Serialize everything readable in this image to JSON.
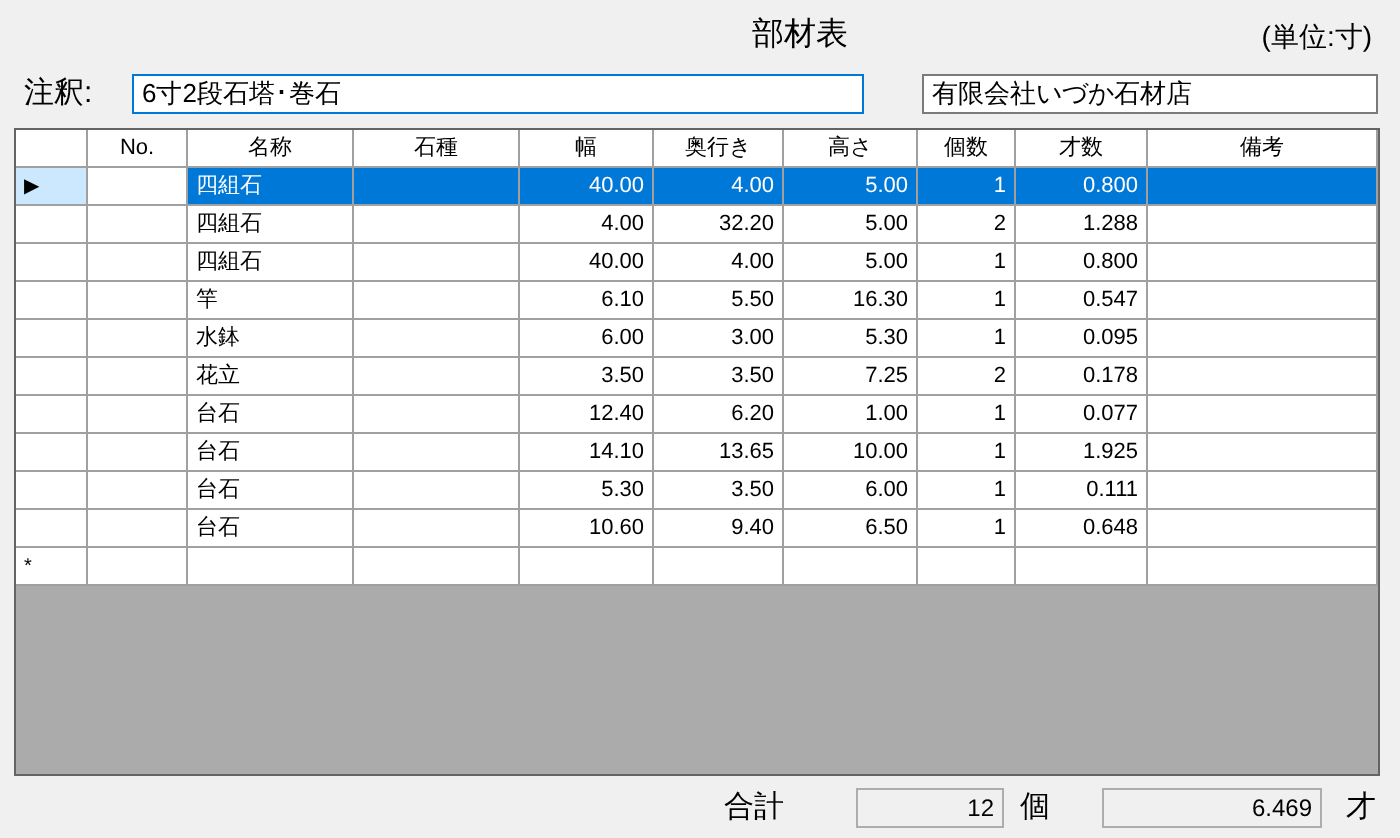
{
  "title": "部材表",
  "unit": "(単位:寸)",
  "note": {
    "label": "注釈:",
    "value": "6寸2段石塔･巻石"
  },
  "company": {
    "value": "有限会社いづか石材店"
  },
  "table": {
    "columns": [
      {
        "label": "No."
      },
      {
        "label": "名称"
      },
      {
        "label": "石種"
      },
      {
        "label": "幅"
      },
      {
        "label": "奥行き"
      },
      {
        "label": "高さ"
      },
      {
        "label": "個数"
      },
      {
        "label": "才数"
      },
      {
        "label": "備考"
      }
    ],
    "rows": [
      {
        "selected": true,
        "marker": "▶",
        "cells": [
          "",
          "四組石",
          "",
          "40.00",
          "4.00",
          "5.00",
          "1",
          "0.800",
          ""
        ]
      },
      {
        "selected": false,
        "cells": [
          "",
          "四組石",
          "",
          "4.00",
          "32.20",
          "5.00",
          "2",
          "1.288",
          ""
        ]
      },
      {
        "selected": false,
        "cells": [
          "",
          "四組石",
          "",
          "40.00",
          "4.00",
          "5.00",
          "1",
          "0.800",
          ""
        ]
      },
      {
        "selected": false,
        "cells": [
          "",
          "竿",
          "",
          "6.10",
          "5.50",
          "16.30",
          "1",
          "0.547",
          ""
        ]
      },
      {
        "selected": false,
        "cells": [
          "",
          "水鉢",
          "",
          "6.00",
          "3.00",
          "5.30",
          "1",
          "0.095",
          ""
        ]
      },
      {
        "selected": false,
        "cells": [
          "",
          "花立",
          "",
          "3.50",
          "3.50",
          "7.25",
          "2",
          "0.178",
          ""
        ]
      },
      {
        "selected": false,
        "cells": [
          "",
          "台石",
          "",
          "12.40",
          "6.20",
          "1.00",
          "1",
          "0.077",
          ""
        ]
      },
      {
        "selected": false,
        "cells": [
          "",
          "台石",
          "",
          "14.10",
          "13.65",
          "10.00",
          "1",
          "1.925",
          ""
        ]
      },
      {
        "selected": false,
        "cells": [
          "",
          "台石",
          "",
          "5.30",
          "3.50",
          "6.00",
          "1",
          "0.111",
          ""
        ]
      },
      {
        "selected": false,
        "cells": [
          "",
          "台石",
          "",
          "10.60",
          "9.40",
          "6.50",
          "1",
          "0.648",
          ""
        ]
      }
    ],
    "new_row": {
      "marker": "*"
    }
  },
  "totals": {
    "label": "合計",
    "count": "12",
    "count_unit": "個",
    "volume": "6.469",
    "volume_unit": "才"
  }
}
